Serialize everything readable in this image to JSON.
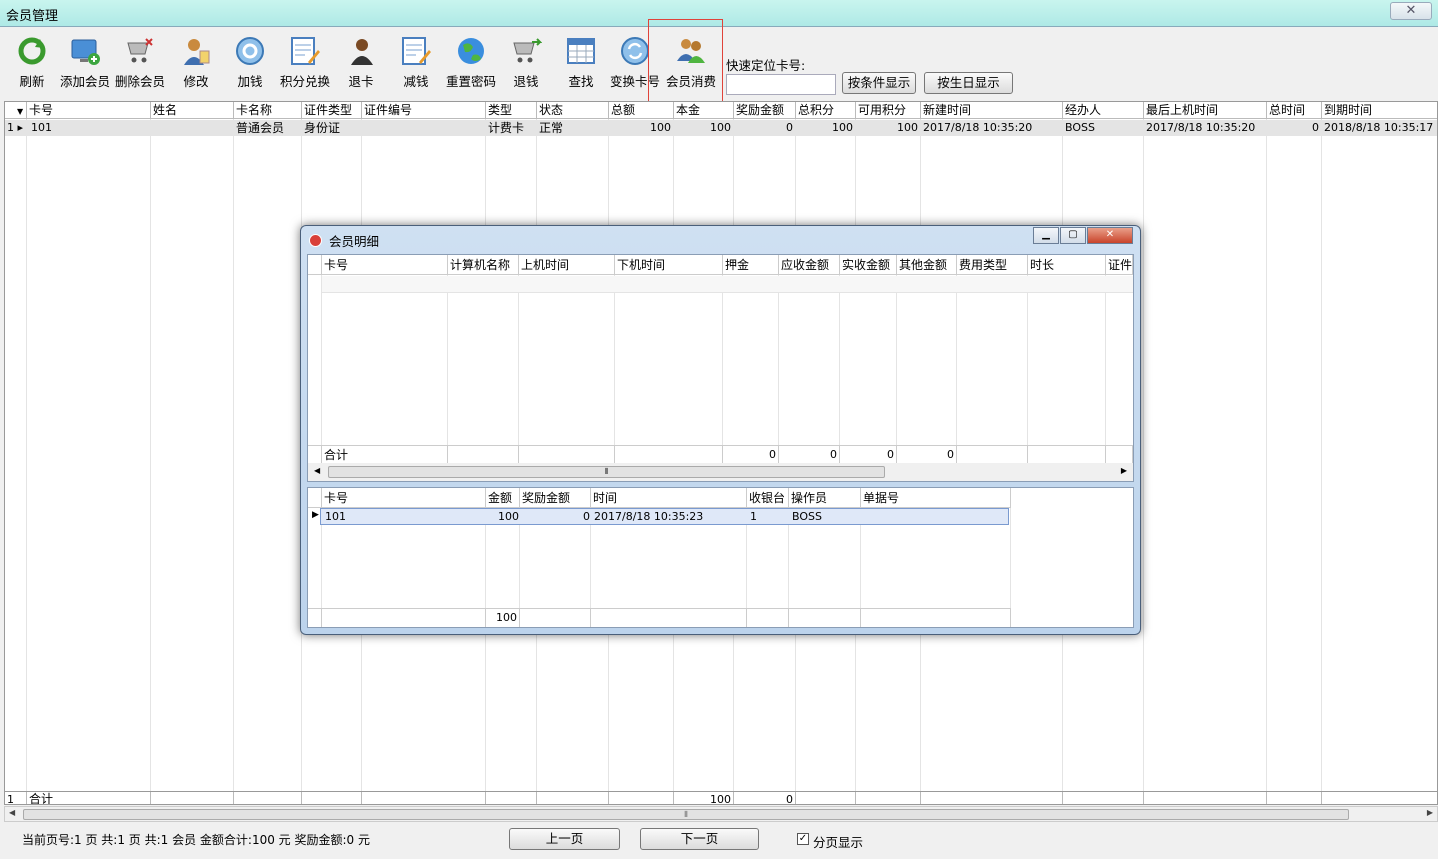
{
  "window": {
    "title": "会员管理",
    "close_glyph": "✕"
  },
  "toolbar": {
    "buttons": [
      {
        "label": "刷新",
        "icon": "refresh-icon"
      },
      {
        "label": "添加会员",
        "icon": "add-member-icon"
      },
      {
        "label": "删除会员",
        "icon": "cart-delete-icon"
      },
      {
        "label": "修改",
        "icon": "edit-user-icon"
      },
      {
        "label": "加钱",
        "icon": "add-money-icon"
      },
      {
        "label": "积分兑换",
        "icon": "points-exchange-icon"
      },
      {
        "label": "退卡",
        "icon": "return-card-icon"
      },
      {
        "label": "减钱",
        "icon": "subtract-money-icon"
      },
      {
        "label": "重置密码",
        "icon": "globe-icon"
      },
      {
        "label": "退钱",
        "icon": "cart-refund-icon"
      },
      {
        "label": "查找",
        "icon": "find-icon"
      },
      {
        "label": "变换卡号",
        "icon": "swap-card-icon"
      },
      {
        "label": "会员消费",
        "icon": "member-consume-icon"
      }
    ],
    "quick_locate_label": "快速定位卡号:",
    "quick_locate_value": "",
    "filter_button": "按条件显示",
    "birthday_button": "按生日显示"
  },
  "grid": {
    "columns": [
      "卡号",
      "姓名",
      "卡名称",
      "证件类型",
      "证件编号",
      "类型",
      "状态",
      "总额",
      "本金",
      "奖励金额",
      "总积分",
      "可用积分",
      "新建时间",
      "经办人",
      "最后上机时间",
      "总时间",
      "到期时间"
    ],
    "rows": [
      {
        "index": "1",
        "cells": [
          "101",
          "",
          "普通会员",
          "身份证",
          "",
          "计费卡",
          "正常",
          "100",
          "100",
          "0",
          "100",
          "100",
          "2017/8/18 10:35:20",
          "BOSS",
          "2017/8/18 10:35:20",
          "0",
          "2018/8/18 10:35:17"
        ]
      }
    ],
    "footer": {
      "index": "1",
      "label": "合计",
      "principal_total": "100",
      "reward_total": "0"
    }
  },
  "status_text": "当前页号:1 页 共:1 页 共:1 会员 金额合计:100 元 奖励金额:0 元",
  "pager": {
    "prev": "上一页",
    "next": "下一页",
    "paging_label": "分页显示",
    "paging_checked": "✓"
  },
  "dialog": {
    "title": "会员明细",
    "top_table": {
      "columns": [
        "卡号",
        "计算机名称",
        "上机时间",
        "下机时间",
        "押金",
        "应收金额",
        "实收金额",
        "其他金额",
        "费用类型",
        "时长",
        "证件"
      ],
      "footer": {
        "label": "合计",
        "deposit": "0",
        "receivable": "0",
        "received": "0",
        "other": "0"
      }
    },
    "bottom_table": {
      "columns": [
        "卡号",
        "金额",
        "奖励金额",
        "时间",
        "收银台",
        "操作员",
        "单据号"
      ],
      "rows": [
        {
          "cells": [
            "101",
            "100",
            "0",
            "2017/8/18 10:35:23",
            "1",
            "BOSS",
            ""
          ]
        }
      ],
      "footer": {
        "amount_total": "100"
      }
    }
  }
}
